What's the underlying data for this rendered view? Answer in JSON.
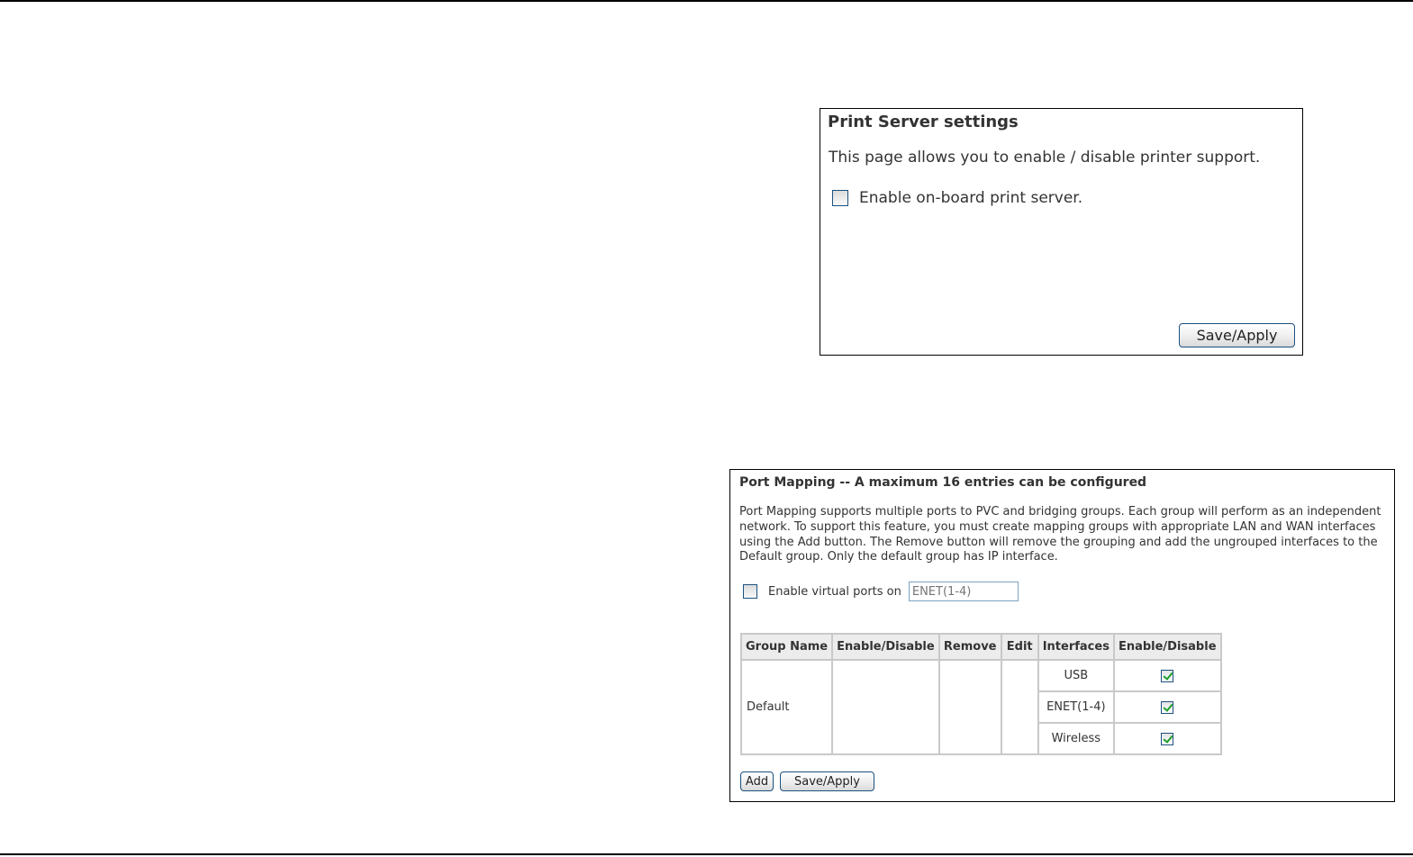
{
  "print_server": {
    "title": "Print Server settings",
    "description": "This page allows you to enable / disable printer support.",
    "enable_label": "Enable on-board print server.",
    "enable_checked": false,
    "save_label": "Save/Apply"
  },
  "port_mapping": {
    "title": "Port Mapping -- A maximum 16 entries can be configured",
    "description": "Port Mapping supports multiple ports to PVC and bridging groups. Each group will perform as an independent network. To support this feature, you must create mapping groups with appropriate LAN and WAN interfaces using the Add button. The Remove button will remove the grouping and add the ungrouped interfaces to the Default group. Only the default group has IP interface.",
    "virtual_ports_label": "Enable virtual ports on",
    "virtual_ports_checked": false,
    "virtual_ports_placeholder": "ENET(1-4)",
    "columns": [
      "Group Name",
      "Enable/Disable",
      "Remove",
      "Edit",
      "Interfaces",
      "Enable/Disable"
    ],
    "group_name": "Default",
    "interfaces": [
      {
        "name": "USB",
        "enabled": true
      },
      {
        "name": "ENET(1-4)",
        "enabled": true
      },
      {
        "name": "Wireless",
        "enabled": true
      }
    ],
    "add_label": "Add",
    "save_label": "Save/Apply"
  }
}
